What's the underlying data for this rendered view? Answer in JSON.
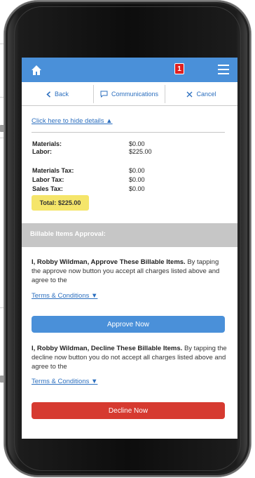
{
  "header": {
    "notification_count": "1",
    "brand_color": "#4a90d9"
  },
  "nav": {
    "back_label": "Back",
    "communications_label": "Communications",
    "cancel_label": "Cancel"
  },
  "details": {
    "hide_link": "Click here to hide details ▲",
    "rows": [
      {
        "label": "Materials:",
        "value": "$0.00"
      },
      {
        "label": "Labor:",
        "value": "$225.00"
      },
      {
        "label": "Materials Tax:",
        "value": "$0.00"
      },
      {
        "label": "Labor Tax:",
        "value": "$0.00"
      },
      {
        "label": "Sales Tax:",
        "value": "$0.00"
      }
    ],
    "total_label": "Total: $225.00"
  },
  "approval": {
    "section_title": "Billable Items Approval:",
    "approve_bold": "I, Robby Wildman, Approve These Billable Items.",
    "approve_text": "By tapping the approve now button you accept all charges listed above and agree to the",
    "terms_label": "Terms & Conditions ▼",
    "approve_button": "Approve Now",
    "decline_bold": "I, Robby Wildman, Decline These Billable Items.",
    "decline_text": "By tapping the decline now button you do not accept all charges listed above and agree to the",
    "terms_label_2": "Terms & Conditions ▼",
    "decline_button": "Decline Now",
    "approve_color": "#4a90d9",
    "decline_color": "#d63a30"
  },
  "icons": [
    "home-icon",
    "menu-icon",
    "chevron-left-icon",
    "chat-icon",
    "close-icon"
  ]
}
